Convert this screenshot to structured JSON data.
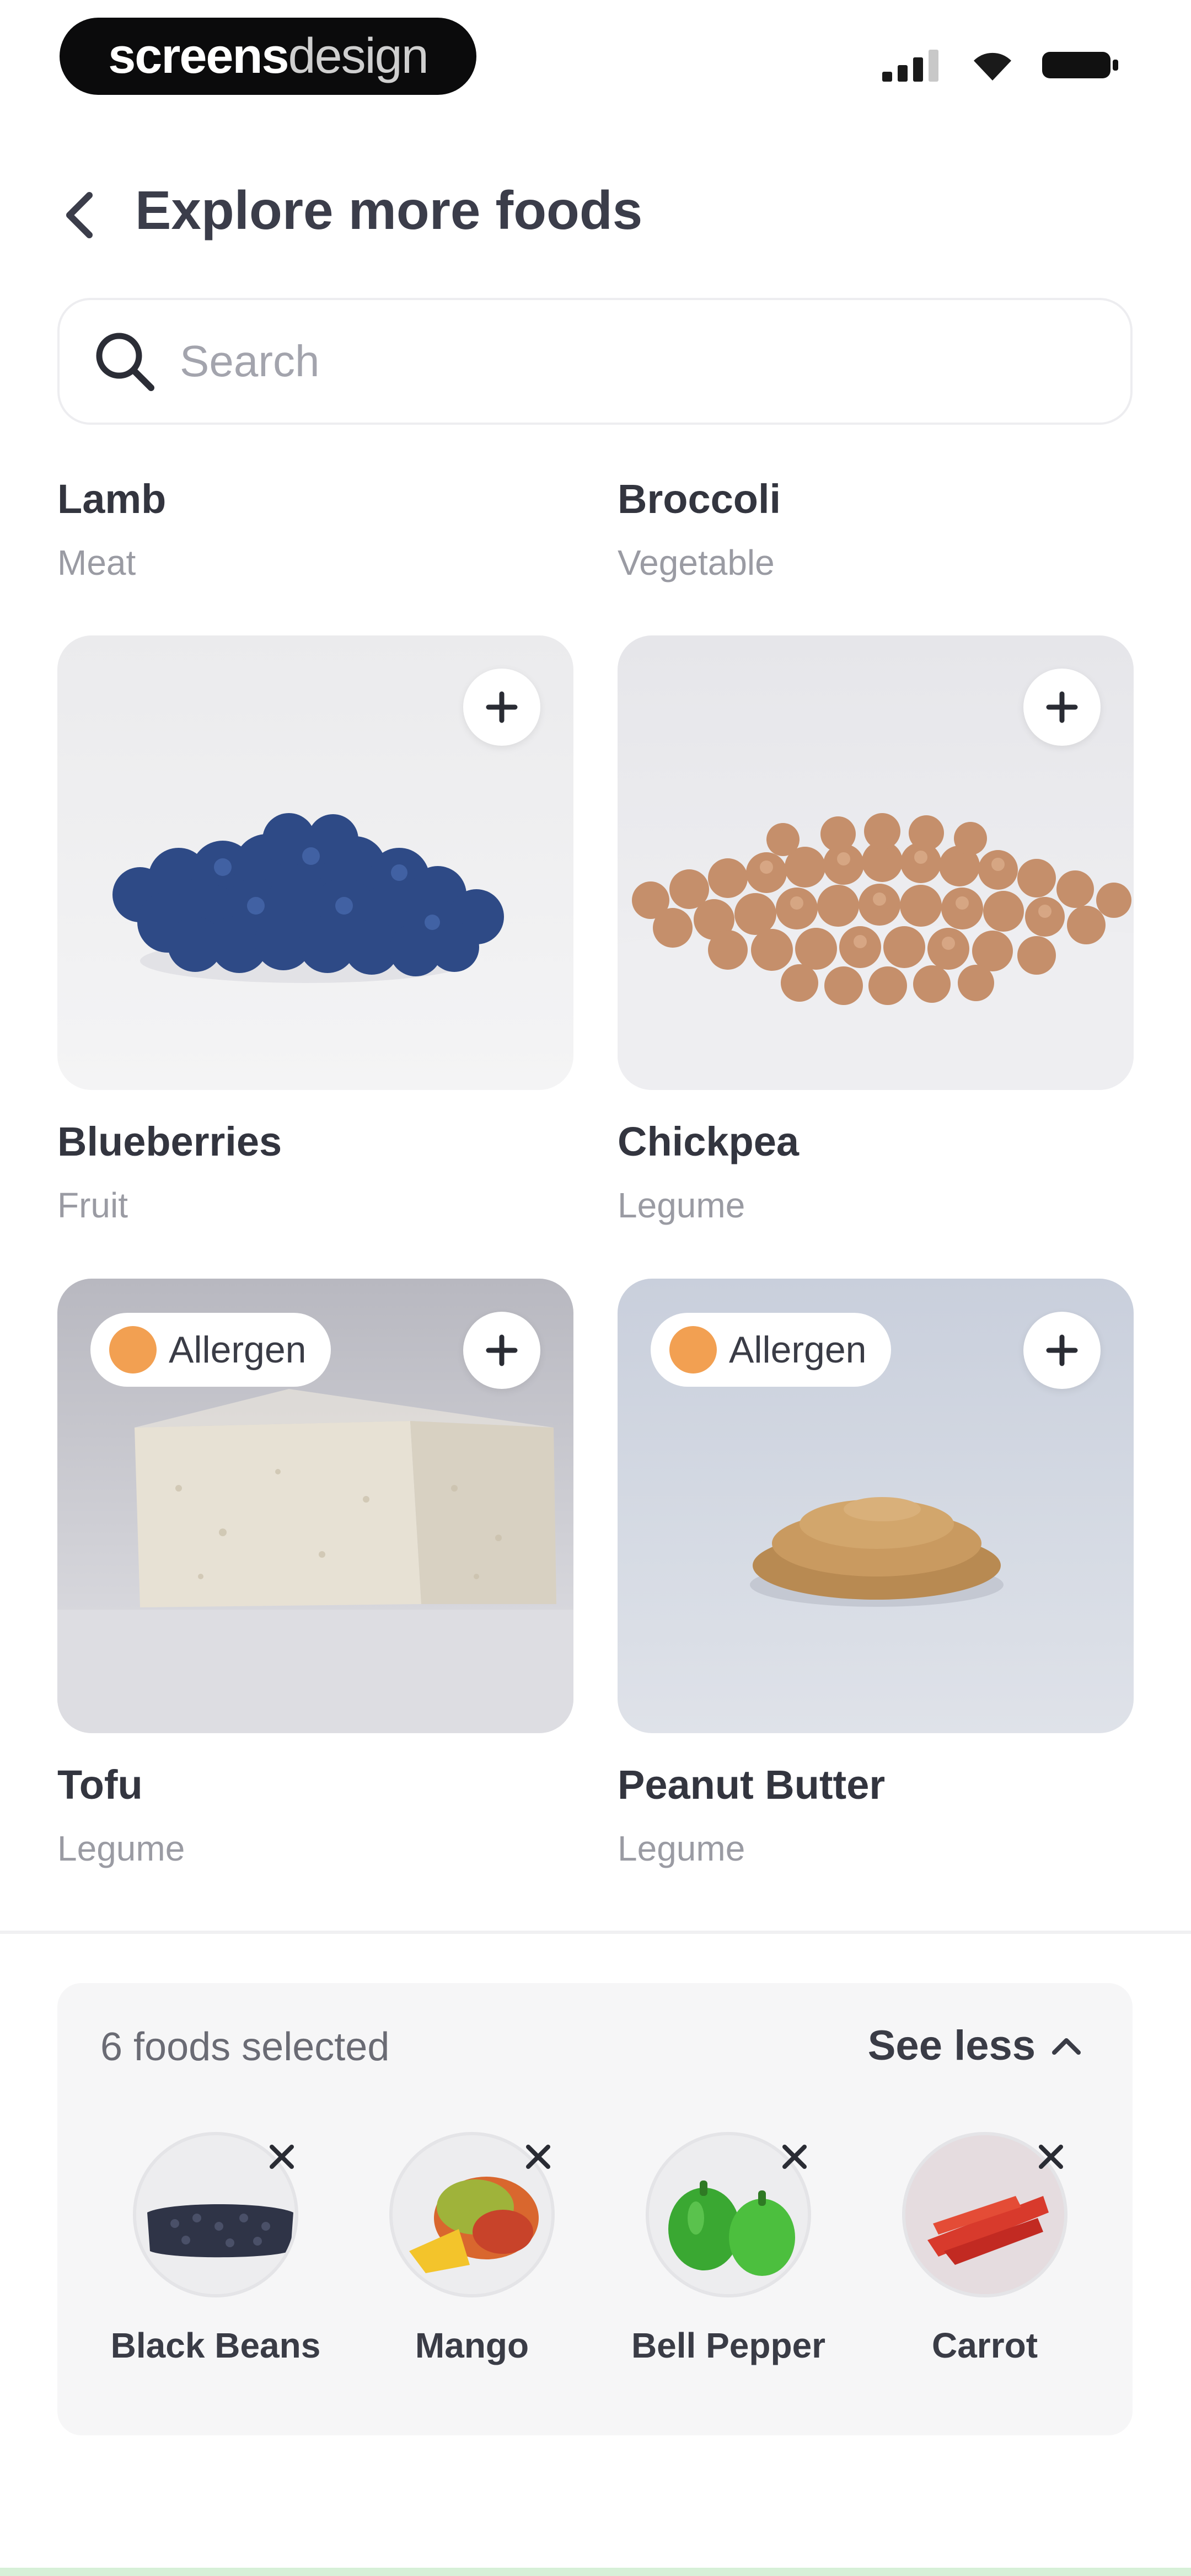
{
  "status_bar": {
    "brand_bold": "screens",
    "brand_light": "design"
  },
  "header": {
    "title": "Explore more foods",
    "back_icon": "chevron-left-icon"
  },
  "search": {
    "placeholder": "Search",
    "icon": "search-icon"
  },
  "foods": [
    {
      "name": "Lamb",
      "category": "Meat"
    },
    {
      "name": "Broccoli",
      "category": "Vegetable"
    },
    {
      "name": "Blueberries",
      "category": "Fruit",
      "allergen": false
    },
    {
      "name": "Chickpea",
      "category": "Legume",
      "allergen": false
    },
    {
      "name": "Tofu",
      "category": "Legume",
      "allergen": true
    },
    {
      "name": "Peanut Butter",
      "category": "Legume",
      "allergen": true
    }
  ],
  "allergen_label": "Allergen",
  "selection": {
    "count_text": "6 foods selected",
    "toggle_label": "See less",
    "items": [
      {
        "name": "Black Beans"
      },
      {
        "name": "Mango"
      },
      {
        "name": "Bell Pepper"
      },
      {
        "name": "Carrot"
      }
    ]
  },
  "colors": {
    "allergen_dot": "#f2a052",
    "title": "#3b3d4a",
    "muted": "#9a9ba3",
    "panel_bg": "#f6f6f7"
  }
}
